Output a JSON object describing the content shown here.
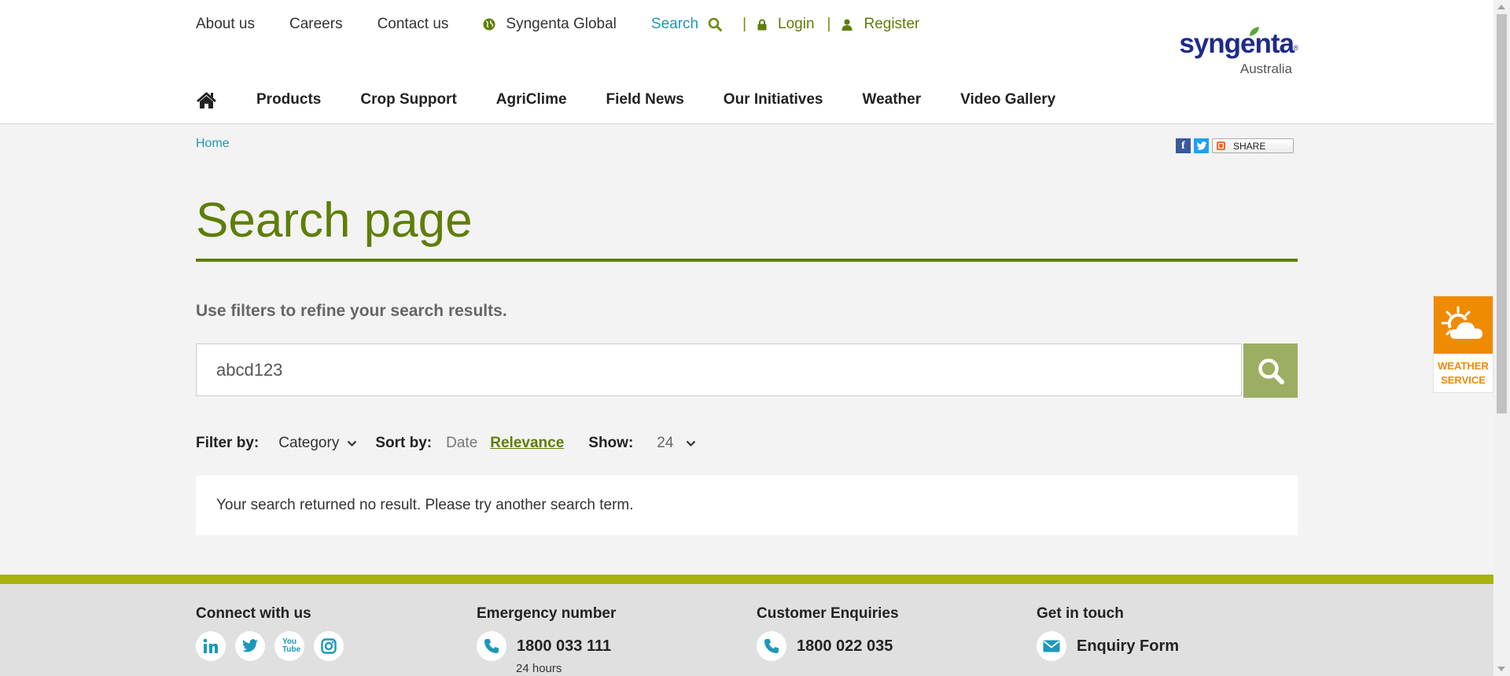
{
  "utility_nav": {
    "about": "About us",
    "careers": "Careers",
    "contact": "Contact us",
    "global": "Syngenta Global",
    "search": "Search",
    "separator": "|",
    "login": "Login",
    "register": "Register"
  },
  "logo": {
    "wordmark": "syngenta",
    "registered": "®",
    "country": "Australia"
  },
  "main_nav": [
    "Products",
    "Crop Support",
    "AgriClime",
    "Field News",
    "Our Initiatives",
    "Weather",
    "Video Gallery"
  ],
  "breadcrumb": {
    "home": "Home"
  },
  "share": {
    "facebook": "f",
    "share_label": "SHARE"
  },
  "page": {
    "title": "Search page",
    "subtitle": "Use filters to refine your search results.",
    "search_value": "abcd123"
  },
  "filters": {
    "filter_label": "Filter by:",
    "category": "Category",
    "sort_label": "Sort by:",
    "sort_date": "Date",
    "sort_relevance": "Relevance",
    "show_label": "Show:",
    "show_value": "24"
  },
  "results": {
    "message": "Your search returned no result. Please try another search term."
  },
  "weather_widget": {
    "line1": "WEATHER",
    "line2": "SERVICE"
  },
  "footer": {
    "connect": {
      "title": "Connect with us",
      "icons": [
        "linkedin-icon",
        "twitter-icon",
        "youtube-icon",
        "instagram-icon"
      ],
      "youtube_text": "You Tube"
    },
    "emergency": {
      "title": "Emergency number",
      "number": "1800 033 111",
      "note": "24 hours"
    },
    "enquiries": {
      "title": "Customer Enquiries",
      "number": "1800 022 035"
    },
    "touch": {
      "title": "Get in touch",
      "link": "Enquiry Form"
    }
  },
  "colors": {
    "brand_green": "#5e7e07",
    "link_blue": "#1d97b9",
    "search_button": "#9cae61",
    "weather_orange": "#ef8b00",
    "footer_band": "#a8b30c",
    "logo_blue": "#1f2b8a"
  }
}
